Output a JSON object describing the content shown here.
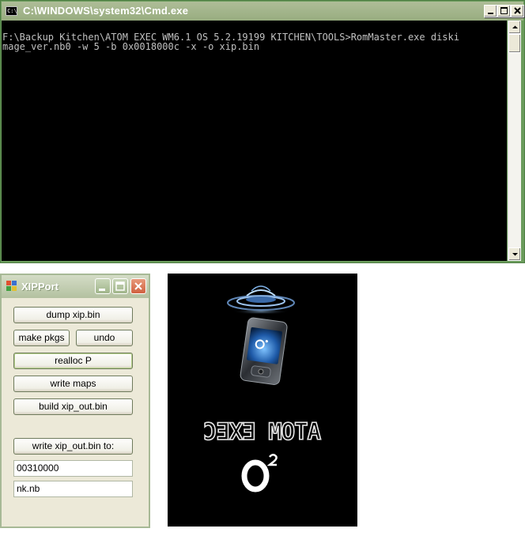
{
  "cmd_window": {
    "title": "C:\\WINDOWS\\system32\\Cmd.exe",
    "icon_text": "C:\\",
    "console_lines": [
      "F:\\Backup Kitchen\\ATOM EXEC WM6.1 OS 5.2.19199 KITCHEN\\TOOLS>RomMaster.exe diski",
      "mage_ver.nb0 -w 5 -b 0x0018000c -x -o xip.bin"
    ]
  },
  "xipport": {
    "title": "XIPPort",
    "buttons": {
      "dump": "dump xip.bin",
      "make_pkgs": "make pkgs",
      "undo": "undo",
      "realloc": "realloc P",
      "write_maps": "write maps",
      "build": "build xip_out.bin",
      "write_to": "write xip_out.bin to:"
    },
    "fields": {
      "address": "00310000",
      "filename": "nk.nb"
    }
  },
  "splash": {
    "mirrored_text": "ATOM EXEC",
    "logo_text": "O2"
  }
}
